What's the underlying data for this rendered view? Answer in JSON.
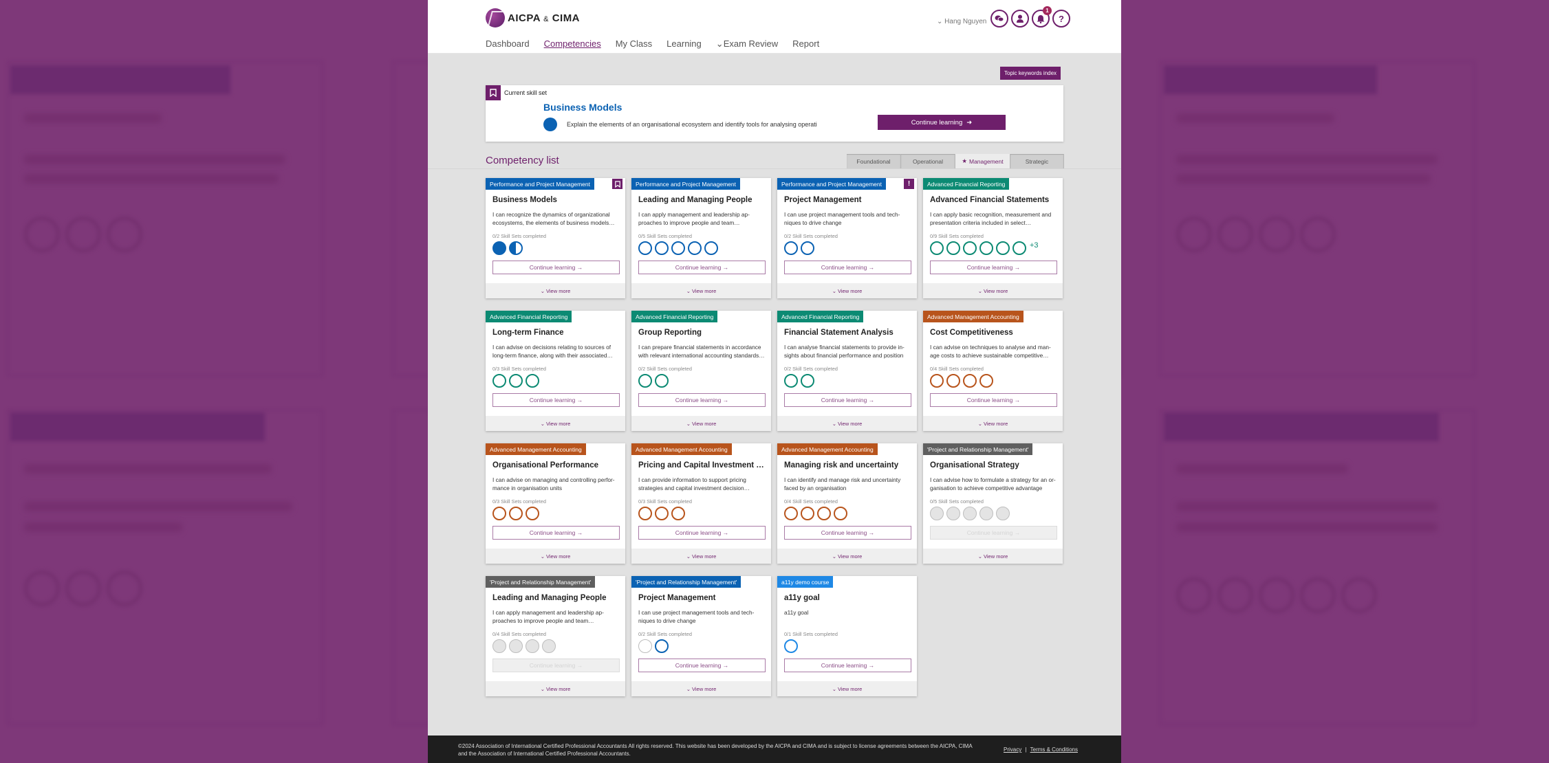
{
  "brand": {
    "name": "AICPA",
    "amp": "&",
    "name2": "CIMA",
    "accent": "#6e1f6b"
  },
  "header": {
    "user_name": "Hang Nguyen",
    "notification_count": "1",
    "icons": [
      "chat-icon",
      "profile-icon",
      "bell-icon",
      "help-icon"
    ]
  },
  "nav": {
    "items": [
      {
        "label": "Dashboard",
        "active": false
      },
      {
        "label": "Competencies",
        "active": true
      },
      {
        "label": "My Class",
        "active": false
      },
      {
        "label": "Learning",
        "active": false
      },
      {
        "label": "Exam Review",
        "active": false,
        "dropdown": true
      },
      {
        "label": "Report",
        "active": false
      }
    ]
  },
  "topic_button": "Topic keywords index",
  "current_skill": {
    "label": "Current skill set",
    "title": "Business Models",
    "description": "Explain the elements of an organisational ecosystem and identify tools for analysing operati",
    "button": "Continue learning"
  },
  "competency_list": {
    "title": "Competency list",
    "tabs": [
      {
        "label": "Foundational",
        "active": false
      },
      {
        "label": "Operational",
        "active": false
      },
      {
        "label": "Management",
        "active": true,
        "icon": "star-icon"
      },
      {
        "label": "Strategic",
        "active": false
      }
    ],
    "continue_label": "Continue learning →",
    "view_more_label": "View more",
    "cards": [
      {
        "tag": "Performance and Project Management",
        "tag_color": "#0b62b3",
        "ring_color": "#0b62b3",
        "corner": "bookmark",
        "title": "Business Models",
        "desc": "I can recognize the dynamics of organizational ecosystems, the elements of business models…",
        "progress": "0/2 Skill Sets completed",
        "rings": [
          "full",
          "half"
        ],
        "disabled": false
      },
      {
        "tag": "Performance and Project Management",
        "tag_color": "#0b62b3",
        "ring_color": "#0b62b3",
        "title": "Leading and Managing People",
        "desc": "I can apply management and leadership ap-proaches to improve people and team…",
        "progress": "0/5 Skill Sets completed",
        "rings": [
          "empty",
          "empty",
          "empty",
          "empty",
          "empty"
        ],
        "disabled": false
      },
      {
        "tag": "Performance and Project Management",
        "tag_color": "#0b62b3",
        "ring_color": "#0b62b3",
        "corner": "alert",
        "title": "Project Management",
        "desc": "I can use project management tools and tech-niques to drive change",
        "progress": "0/2 Skill Sets completed",
        "rings": [
          "empty",
          "empty"
        ],
        "disabled": false
      },
      {
        "tag": "Advanced Financial Reporting",
        "tag_color": "#0c8a73",
        "ring_color": "#0c8a73",
        "title": "Advanced Financial Statements",
        "desc": "I can apply basic recognition, measurement and presentation criteria included in select…",
        "progress": "0/9 Skill Sets completed",
        "rings": [
          "empty",
          "empty",
          "empty",
          "empty",
          "empty",
          "empty"
        ],
        "more": "+3",
        "disabled": false
      },
      {
        "tag": "Advanced Financial Reporting",
        "tag_color": "#0c8a73",
        "ring_color": "#0c8a73",
        "title": "Long-term Finance",
        "desc": "I can advise on decisions relating to sources of long-term finance, along with their associated…",
        "progress": "0/3 Skill Sets completed",
        "rings": [
          "empty",
          "empty",
          "empty"
        ],
        "disabled": false
      },
      {
        "tag": "Advanced Financial Reporting",
        "tag_color": "#0c8a73",
        "ring_color": "#0c8a73",
        "title": "Group Reporting",
        "desc": "I can prepare financial statements in accordance with relevant international accounting standards…",
        "progress": "0/2 Skill Sets completed",
        "rings": [
          "empty",
          "empty"
        ],
        "disabled": false
      },
      {
        "tag": "Advanced Financial Reporting",
        "tag_color": "#0c8a73",
        "ring_color": "#0c8a73",
        "title": "Financial Statement Analysis",
        "desc": "I can analyse financial statements to provide in-sights about financial performance and position",
        "progress": "0/2 Skill Sets completed",
        "rings": [
          "empty",
          "empty"
        ],
        "disabled": false
      },
      {
        "tag": "Advanced Management Accounting",
        "tag_color": "#b8541c",
        "ring_color": "#b8541c",
        "title": "Cost Competitiveness",
        "desc": "I can advise on techniques to analyse and man-age costs to achieve sustainable competitive…",
        "progress": "0/4 Skill Sets completed",
        "rings": [
          "empty",
          "empty",
          "empty",
          "empty"
        ],
        "disabled": false
      },
      {
        "tag": "Advanced Management Accounting",
        "tag_color": "#b8541c",
        "ring_color": "#b8541c",
        "title": "Organisational Performance",
        "desc": "I can advise on managing and controlling perfor-mance in organisation units",
        "progress": "0/3 Skill Sets completed",
        "rings": [
          "empty",
          "empty",
          "empty"
        ],
        "disabled": false
      },
      {
        "tag": "Advanced Management Accounting",
        "tag_color": "#b8541c",
        "ring_color": "#b8541c",
        "title": "Pricing and Capital Investment Decis…",
        "desc": "I can provide information to support pricing strategies and capital investment decision…",
        "progress": "0/3 Skill Sets completed",
        "rings": [
          "empty",
          "empty",
          "empty"
        ],
        "disabled": false
      },
      {
        "tag": "Advanced Management Accounting",
        "tag_color": "#b8541c",
        "ring_color": "#b8541c",
        "title": "Managing risk and uncertainty",
        "desc": "I can identify and manage risk and uncertainty faced by an organisation",
        "progress": "0/4 Skill Sets completed",
        "rings": [
          "empty",
          "empty",
          "empty",
          "empty"
        ],
        "disabled": false
      },
      {
        "tag": "'Project and Relationship Management'",
        "tag_color": "#5f5f5f",
        "ring_color": "#bdbdbd",
        "title": "Organisational Strategy",
        "desc": "I can advise how to formulate a strategy for an or-ganisation to achieve competitive advantage",
        "progress": "0/5 Skill Sets completed",
        "rings": [
          "off",
          "off",
          "off",
          "off",
          "off"
        ],
        "disabled": true
      },
      {
        "tag": "'Project and Relationship Management'",
        "tag_color": "#5f5f5f",
        "ring_color": "#bdbdbd",
        "title": "Leading and Managing People",
        "desc": "I can apply management and leadership ap-proaches to improve people and team…",
        "progress": "0/4 Skill Sets completed",
        "rings": [
          "off",
          "off",
          "off",
          "off"
        ],
        "disabled": true
      },
      {
        "tag": "'Project and Relationship Management'",
        "tag_color": "#0b62b3",
        "ring_color": "#0b62b3",
        "title": "Project Management",
        "desc": "I can use project management tools and tech-niques to drive change",
        "progress": "0/2 Skill Sets completed",
        "rings": [
          "blank",
          "empty"
        ],
        "disabled": false
      },
      {
        "tag": "a11y demo course",
        "tag_color": "#1e88e5",
        "ring_color": "#1e88e5",
        "title": "a11y goal",
        "desc": "a11y goal",
        "progress": "0/1 Skill Sets completed",
        "rings": [
          "empty"
        ],
        "disabled": false
      }
    ]
  },
  "footer": {
    "copyright": "©2024 Association of International Certified Professional Accountants All rights reserved. This website has been developed by the AICPA and CIMA and is subject to license agreements between the AICPA, CIMA and the Association of International Certified Professional Accountants.",
    "privacy": "Privacy",
    "separator": "|",
    "terms": "Terms & Conditions"
  }
}
